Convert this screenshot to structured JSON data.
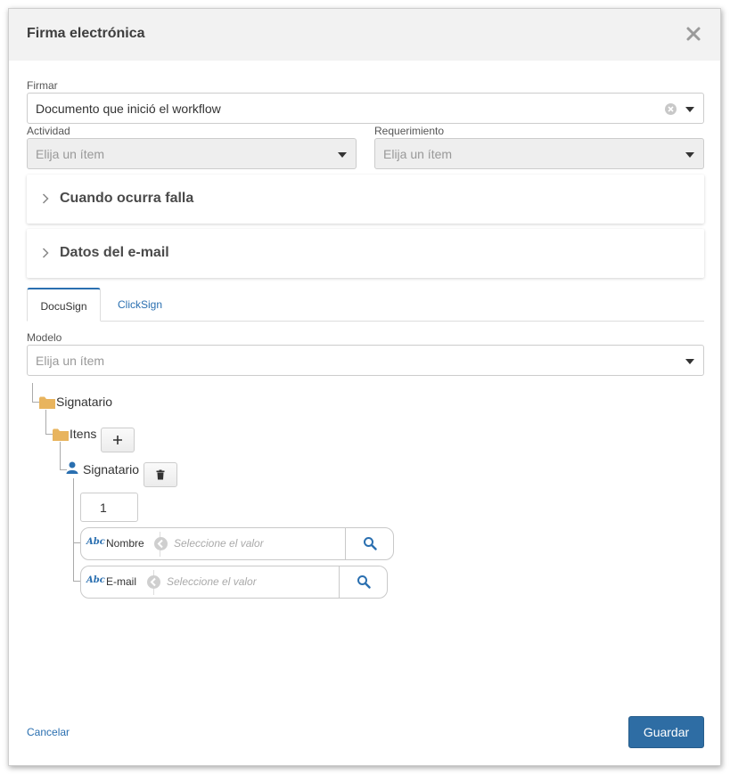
{
  "dialog": {
    "title": "Firma electrónica"
  },
  "form": {
    "firmar": {
      "label": "Firmar",
      "value": "Documento que inició el workflow"
    },
    "actividad": {
      "label": "Actividad",
      "placeholder": "Elija un ítem"
    },
    "requerimiento": {
      "label": "Requerimiento",
      "placeholder": "Elija un ítem"
    }
  },
  "panels": [
    {
      "title": "Cuando ocurra falla"
    },
    {
      "title": "Datos del e-mail"
    }
  ],
  "tabs": [
    {
      "label": "DocuSign",
      "active": true
    },
    {
      "label": "ClickSign",
      "active": false
    }
  ],
  "modelo": {
    "label": "Modelo",
    "placeholder": "Elija un ítem"
  },
  "tree": {
    "root": "Signatario",
    "items": "Itens",
    "signer": "Signatario",
    "order": "1",
    "fields": [
      {
        "abc": "Abc",
        "label": "Nombre",
        "placeholder": "Seleccione el valor"
      },
      {
        "abc": "Abc",
        "label": "E-mail",
        "placeholder": "Seleccione el valor"
      }
    ]
  },
  "footer": {
    "cancel_label": "Cancelar",
    "save_label": "Guardar"
  },
  "colors": {
    "primary": "#2e6da4",
    "link": "#2a6fb0",
    "folder": "#e8b45e",
    "header_bg": "#f2f2f2"
  }
}
